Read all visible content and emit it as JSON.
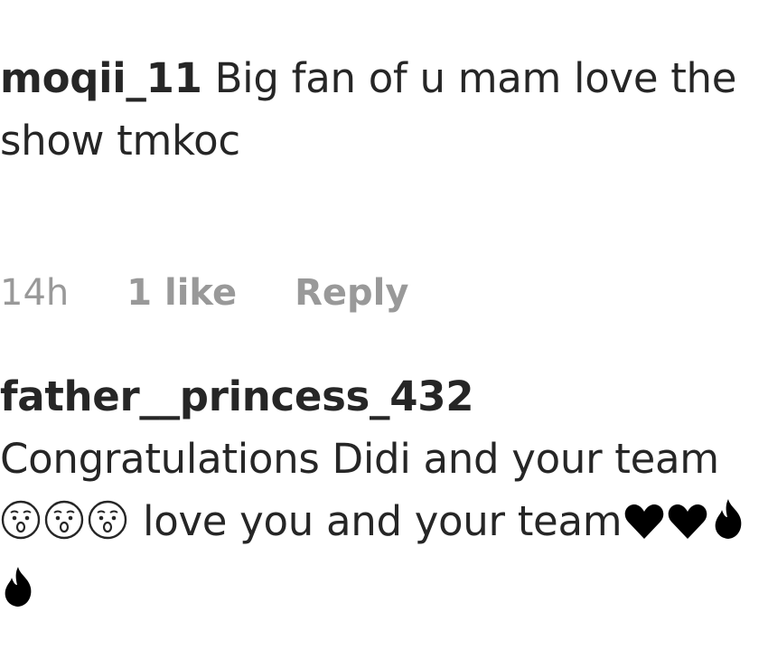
{
  "comments": [
    {
      "username": "moqii_11",
      "text": "Big fan of u mam love the show tmkoc",
      "time": "14h",
      "likes": "1 like",
      "reply_label": "Reply"
    },
    {
      "username": "father__princess_432",
      "text_before_emoji": "Congratulations Didi and your team",
      "text_after_emoji": "love you and your team",
      "emoji_group_1": [
        "hushed-face-icon",
        "hushed-face-icon",
        "hushed-face-icon"
      ],
      "emoji_group_2": [
        "black-heart-icon",
        "black-heart-icon",
        "fire-icon",
        "fire-icon"
      ]
    }
  ]
}
